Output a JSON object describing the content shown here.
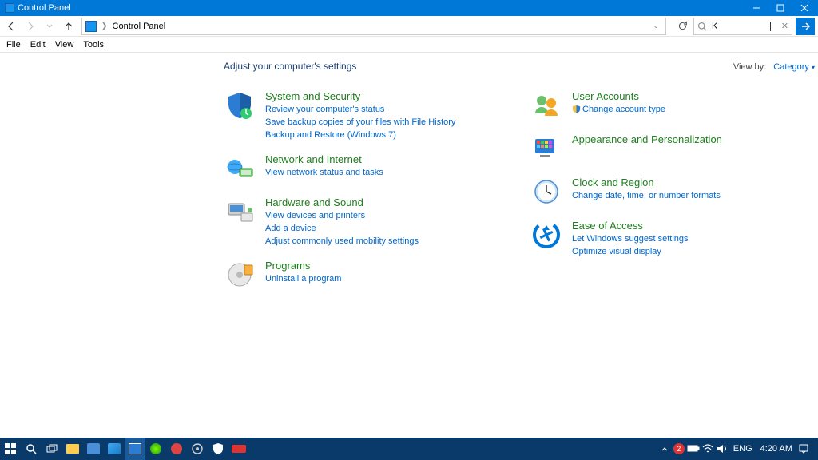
{
  "window": {
    "title": "Control Panel"
  },
  "breadcrumb": {
    "root_icon": "cp-icon",
    "item": "Control Panel"
  },
  "menu": {
    "file": "File",
    "edit": "Edit",
    "view": "View",
    "tools": "Tools"
  },
  "search": {
    "value": "K"
  },
  "page": {
    "heading": "Adjust your computer's settings",
    "viewby_label": "View by:",
    "viewby_value": "Category"
  },
  "left": [
    {
      "title": "System and Security",
      "links": [
        "Review your computer's status",
        "Save backup copies of your files with File History",
        "Backup and Restore (Windows 7)"
      ]
    },
    {
      "title": "Network and Internet",
      "links": [
        "View network status and tasks"
      ]
    },
    {
      "title": "Hardware and Sound",
      "links": [
        "View devices and printers",
        "Add a device",
        "Adjust commonly used mobility settings"
      ]
    },
    {
      "title": "Programs",
      "links": [
        "Uninstall a program"
      ]
    }
  ],
  "right": [
    {
      "title": "User Accounts",
      "links": [
        "Change account type"
      ],
      "shield": [
        true
      ]
    },
    {
      "title": "Appearance and Personalization",
      "links": []
    },
    {
      "title": "Clock and Region",
      "links": [
        "Change date, time, or number formats"
      ]
    },
    {
      "title": "Ease of Access",
      "links": [
        "Let Windows suggest settings",
        "Optimize visual display"
      ]
    }
  ],
  "tray": {
    "notif": "2",
    "lang": "ENG",
    "time": "4:20 AM"
  }
}
